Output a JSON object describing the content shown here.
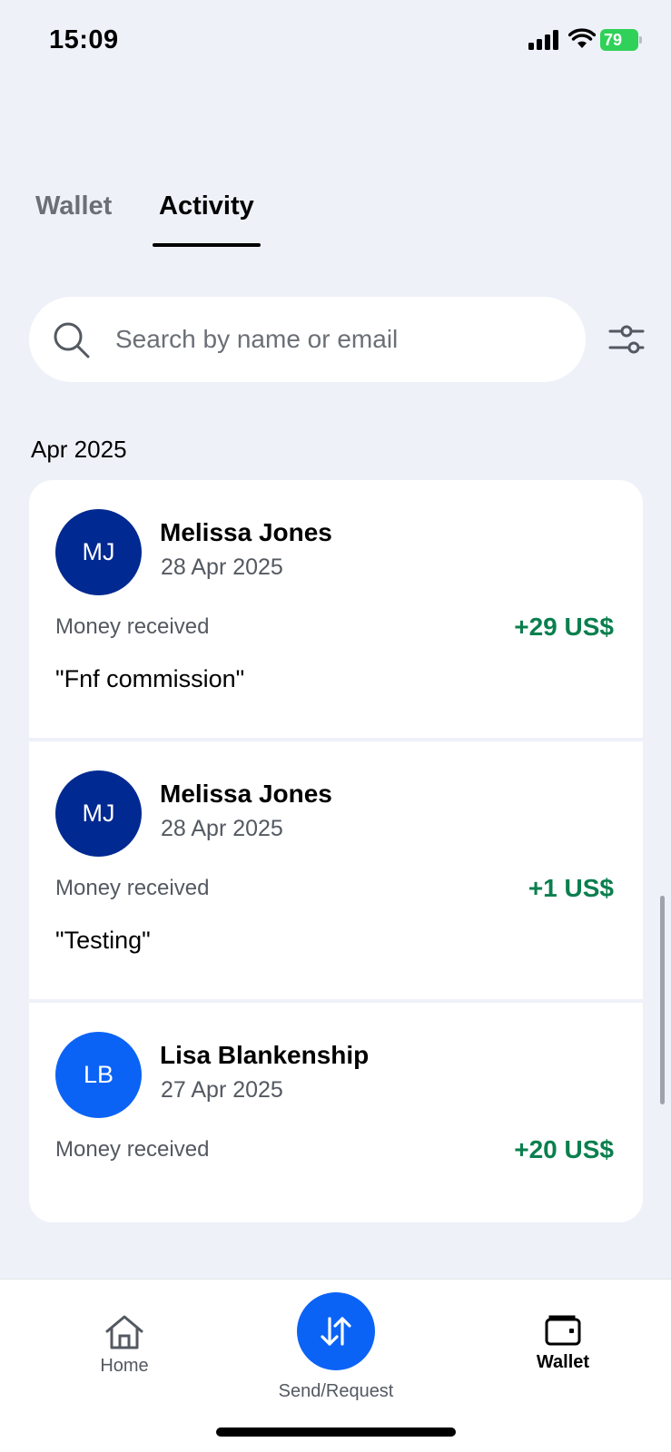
{
  "status_bar": {
    "time": "15:09",
    "battery_level": "79",
    "battery_color": "#30d158"
  },
  "tabs": [
    {
      "label": "Wallet",
      "active": false
    },
    {
      "label": "Activity",
      "active": true
    }
  ],
  "search": {
    "placeholder": "Search by name or email",
    "value": ""
  },
  "month": "Apr 2025",
  "transactions": [
    {
      "initials": "MJ",
      "name": "Melissa Jones",
      "date": "28 Apr 2025",
      "type": "Money received",
      "amount": "+29 US$",
      "note": "\"Fnf commission\"",
      "avatar_color": "#002991"
    },
    {
      "initials": "MJ",
      "name": "Melissa Jones",
      "date": "28 Apr 2025",
      "type": "Money received",
      "amount": "+1 US$",
      "note": "\"Testing\"",
      "avatar_color": "#002991"
    },
    {
      "initials": "LB",
      "name": "Lisa Blankenship",
      "date": "27 Apr 2025",
      "type": "Money received",
      "amount": "+20 US$",
      "note": "",
      "avatar_color": "#0b63f6"
    }
  ],
  "colors": {
    "accent": "#0b63f6",
    "positive_amount": "#0a7f4e",
    "background": "#eef1f8"
  },
  "bottom_nav": {
    "home_label": "Home",
    "send_label": "Send/Request",
    "wallet_label": "Wallet",
    "active": "Wallet"
  }
}
